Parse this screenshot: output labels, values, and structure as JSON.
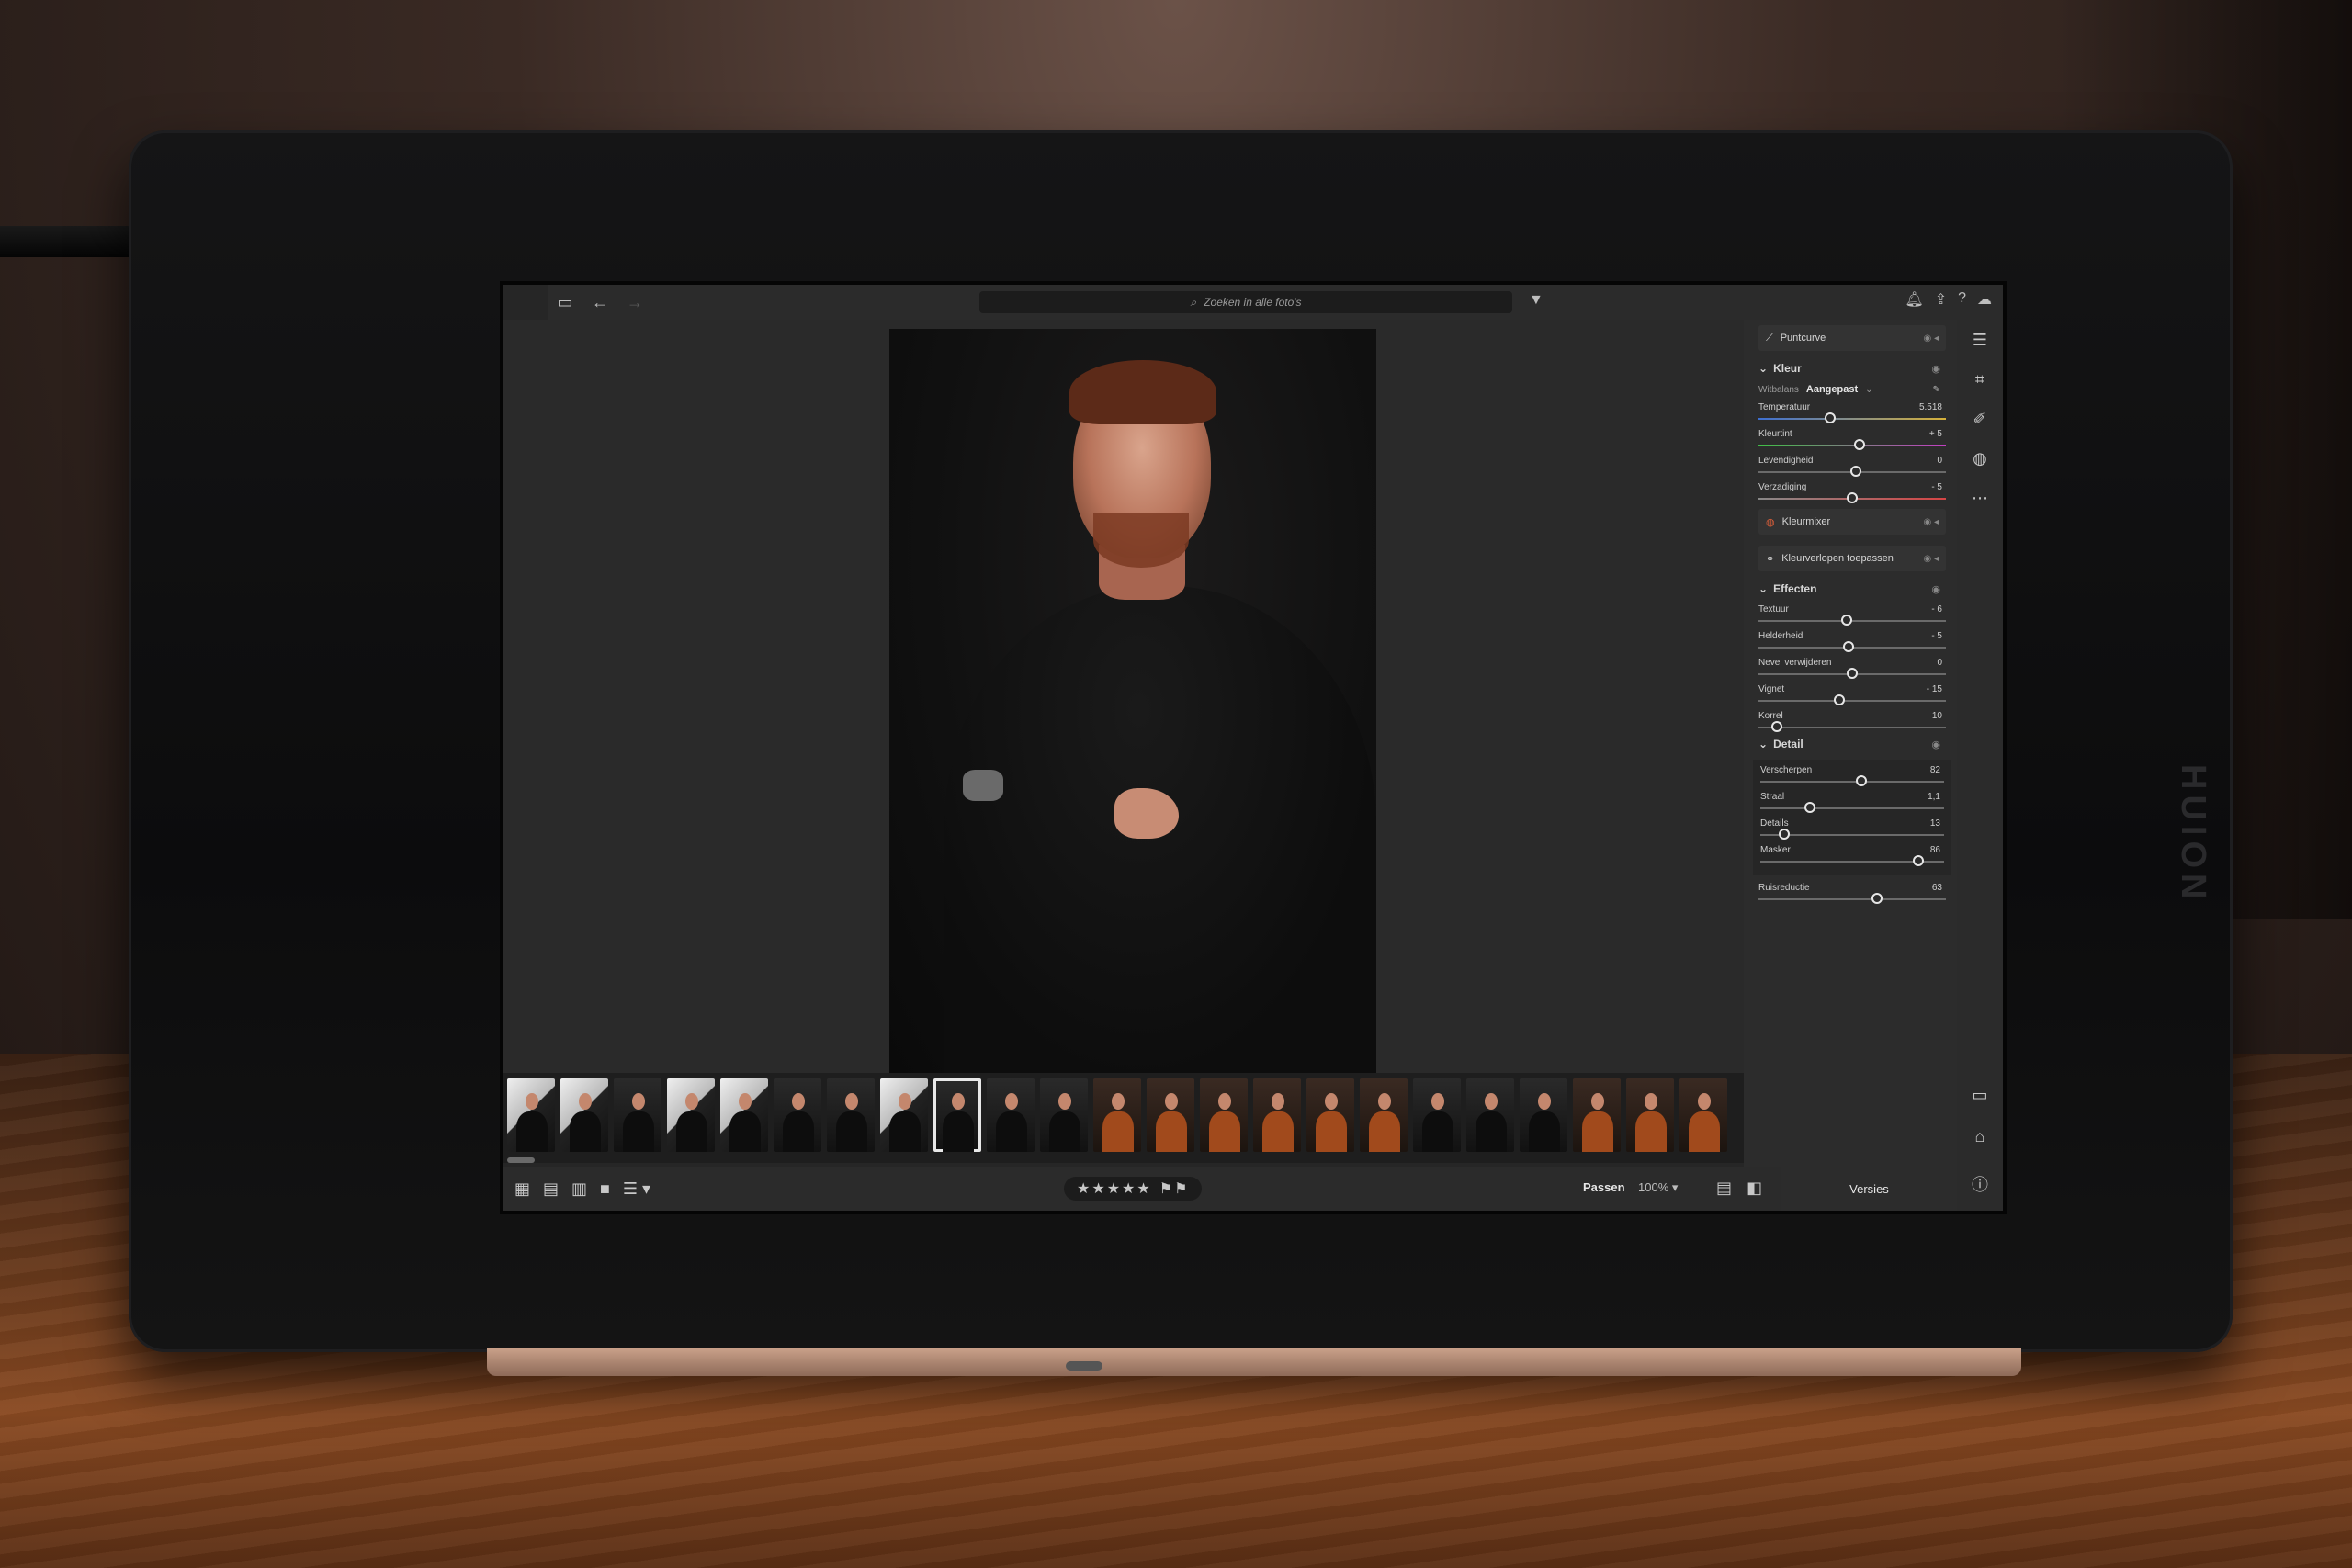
{
  "topbar": {
    "search_placeholder": "Zoeken in alle foto's"
  },
  "panel": {
    "puntcurve_label": "Puntcurve",
    "kleur": {
      "title": "Kleur",
      "wb_label": "Witbalans",
      "wb_value": "Aangepast",
      "sliders": [
        {
          "label": "Temperatuur",
          "value": "5.518",
          "position": 0.38
        },
        {
          "label": "Kleurtint",
          "value": "+ 5",
          "position": 0.54
        },
        {
          "label": "Levendigheid",
          "value": "0",
          "position": 0.52
        },
        {
          "label": "Verzadiging",
          "value": "- 5",
          "position": 0.5
        }
      ]
    },
    "kleurmixer_label": "Kleurmixer",
    "kleurverlopen_label": "Kleurverlopen toepassen",
    "effecten": {
      "title": "Effecten",
      "sliders": [
        {
          "label": "Textuur",
          "value": "- 6",
          "position": 0.47
        },
        {
          "label": "Helderheid",
          "value": "- 5",
          "position": 0.48
        },
        {
          "label": "Nevel verwijderen",
          "value": "0",
          "position": 0.5
        },
        {
          "label": "Vignet",
          "value": "- 15",
          "position": 0.43
        },
        {
          "label": "Korrel",
          "value": "10",
          "position": 0.1
        }
      ]
    },
    "detail": {
      "title": "Detail",
      "sliders": [
        {
          "label": "Verscherpen",
          "value": "82",
          "position": 0.55
        },
        {
          "label": "Straal",
          "value": "1,1",
          "position": 0.27
        },
        {
          "label": "Details",
          "value": "13",
          "position": 0.13
        },
        {
          "label": "Masker",
          "value": "86",
          "position": 0.86
        }
      ],
      "ruisreductie": {
        "label": "Ruisreductie",
        "value": "63",
        "position": 0.63
      }
    }
  },
  "bottombar": {
    "fit_label": "Passen",
    "zoom_label": "100%",
    "versions_label": "Versies",
    "rating": "★★★★★"
  },
  "filmstrip": {
    "selected_index": 8
  },
  "device": {
    "brand": "HUION"
  },
  "icons": [
    "sidebar-toggle-icon",
    "back-arrow-icon",
    "forward-arrow-icon",
    "search-icon",
    "filter-icon",
    "bell-icon",
    "share-icon",
    "help-icon",
    "cloud-icon",
    "eye-icon",
    "eyedropper-icon",
    "grid-icon",
    "sort-icon",
    "flag-icon",
    "info-icon",
    "comment-icon",
    "tag-icon"
  ]
}
